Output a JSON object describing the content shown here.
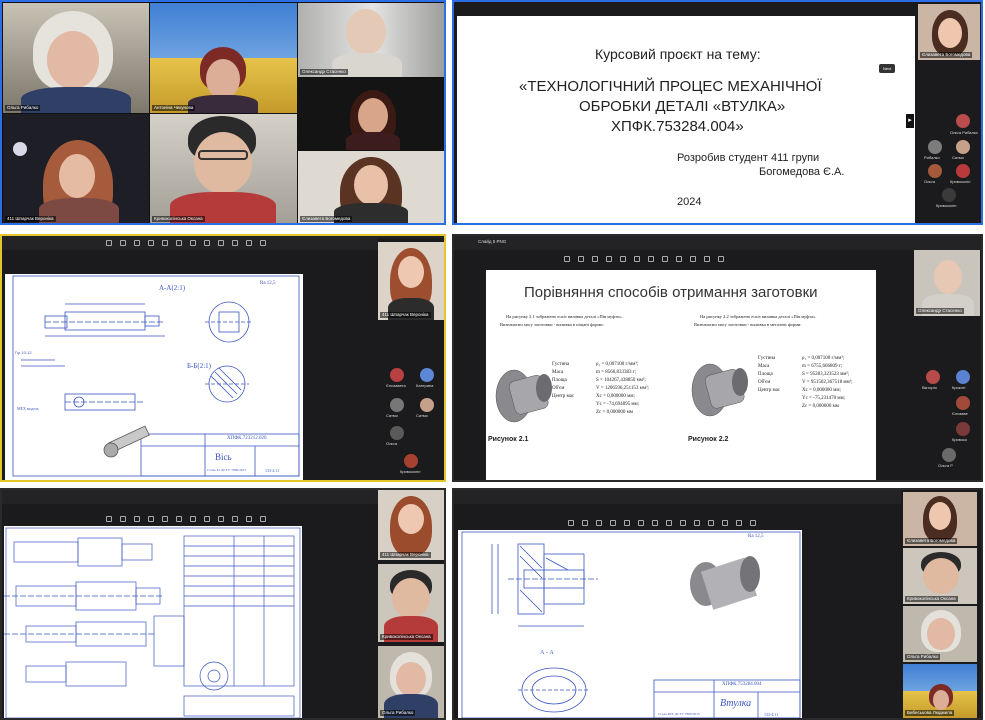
{
  "panel1": {
    "participants": [
      {
        "name": "Ольга Рибалко"
      },
      {
        "name": "Антоніна Чекунова"
      },
      {
        "name": "Олександр Стасенко"
      },
      {
        "name": ""
      },
      {
        "name": "411 Шпарчак Вероніка"
      },
      {
        "name": "Кривоколінська Оксана"
      },
      {
        "name": "Єлизавета Богомедова"
      }
    ]
  },
  "panel2": {
    "slide": {
      "heading": "Курсовий проєкт на тему:",
      "title_line1": "«ТЕХНОЛОГІЧНИЙ ПРОЦЕС МЕХАНІЧНОЇ",
      "title_line2": "ОБРОБКИ ДЕТАЛІ «ВТУЛКА»",
      "title_line3": "ХПФК.753284.004»",
      "author_line1": "Розробив студент 411 групи",
      "author_line2": "Богомедова Є.А.",
      "year": "2024",
      "next_label": "Next"
    },
    "side": [
      {
        "name": "Єлизавета Богомедова"
      },
      {
        "name": "Ольга Рибалко"
      },
      {
        "name": "Рибалко"
      },
      {
        "name": "Сатмо"
      },
      {
        "name": "Ольга"
      },
      {
        "name": "Кривоколін"
      },
      {
        "name": "Оксана"
      },
      {
        "name": "Кривоколін"
      }
    ]
  },
  "panel3": {
    "drawing": {
      "sheet_code": "ХПФК.723212.020",
      "part_name": "Вісь",
      "section_aa": "А-А(2:1)",
      "section_bb": "Б-Б(2:1)",
      "roughness": "Ra 12,5",
      "material": "Сталь 45 ДСТУ 7809:2015",
      "group": "133-4.11",
      "notes_label": "МЕХ модель"
    },
    "side": [
      {
        "name": "411 Шпарчак Вероніка"
      },
      {
        "name": "Єлизавета"
      },
      {
        "name": "Катерина"
      },
      {
        "name": "Сатмо"
      },
      {
        "name": "Сатмо"
      },
      {
        "name": "Ольга"
      },
      {
        "name": "Кривоколін"
      }
    ]
  },
  "panel4": {
    "app_title": "Слайд 5 PNG",
    "slide": {
      "title": "Порівняння способів отримання заготовки",
      "text_left1": "На рисунку 2.1 зображено ескіз виливка деталі «Пів муфти».",
      "text_left2": "Визначаємо масу заготовки - виливка в піщані форми:",
      "text_right1": "На рисунку 2.2 зображено ескіз виливка деталі «Пів муфта».",
      "text_right2": "Визначаємо масу заготовки - виливка в металеві форми:",
      "caption_left": "Рисунок 2.1",
      "caption_right": "Рисунок 2.2",
      "props_left": [
        {
          "label": "Густина",
          "value": "ρ₁ = 0,007100 г/мм³;"
        },
        {
          "label": "Маса",
          "value": "m = 8566,833383 г;"
        },
        {
          "label": "Площа",
          "value": "S = 104267,438850 мм²;"
        },
        {
          "label": "Об'єм",
          "value": "V = 1206596,251153 мм³;"
        },
        {
          "label": "Центр мас",
          "value": "Xc = 0,000000 мм;"
        },
        {
          "label": "",
          "value": "Yc = -74,694895 мм;"
        },
        {
          "label": "",
          "value": "Zc = 0,000000 мм"
        }
      ],
      "props_right": [
        {
          "label": "Густина",
          "value": "ρ₁ = 0,007100 г/мм³;"
        },
        {
          "label": "Маса",
          "value": "m = 6755,666809 г;"
        },
        {
          "label": "Площа",
          "value": "S = 95283,323523 мм²;"
        },
        {
          "label": "Об'єм",
          "value": "V = 951502,367518 мм³;"
        },
        {
          "label": "Центр мас",
          "value": "Xc = 0,000000 мм;"
        },
        {
          "label": "",
          "value": "Yc = -75,231470 мм;"
        },
        {
          "label": "",
          "value": "Zc = 0,000000 мм"
        }
      ]
    },
    "side": [
      {
        "name": "Олександр Стасенко"
      },
      {
        "name": "Вікторія"
      },
      {
        "name": "Крикоті"
      },
      {
        "name": "Єлизаве"
      },
      {
        "name": "Кривоко"
      },
      {
        "name": "Ольга Р"
      }
    ]
  },
  "panel5": {
    "side": [
      {
        "name": "411 Шпарчак Вероніка"
      },
      {
        "name": "Кривоколінська Оксана"
      },
      {
        "name": "Ольга Рибалко"
      }
    ]
  },
  "panel6": {
    "drawing": {
      "sheet_code": "ХПФК.753284.004",
      "part_name": "Втулка",
      "roughness": "Ra 12,5",
      "section_aa": "А - А",
      "material": "Сталь 40Х ДСТУ 7809:2015",
      "group": "133-4.11"
    },
    "side": [
      {
        "name": "Єлизавета Богомедова"
      },
      {
        "name": "Кривоколінська Оксана"
      },
      {
        "name": "Ольга Рибалко"
      },
      {
        "name": "Бибеськова Людмила"
      }
    ]
  },
  "colors": {
    "active_speaker": "#e4c62a",
    "screen_share": "#2c6ee8",
    "cad_blue": "#3a55c0"
  }
}
